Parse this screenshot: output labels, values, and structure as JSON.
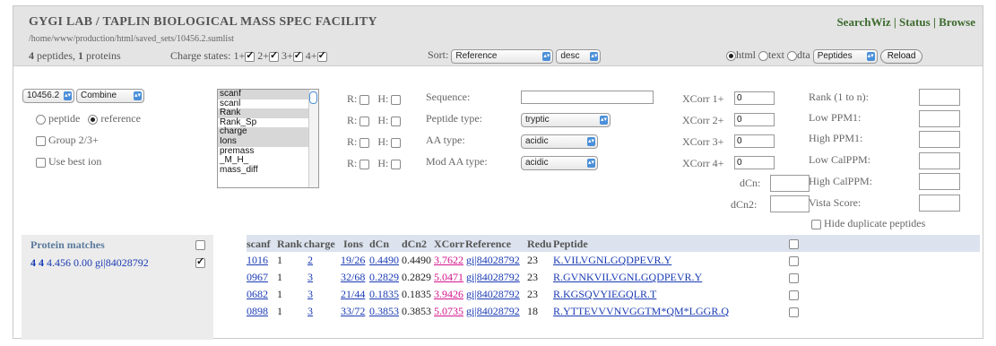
{
  "header": {
    "title": "GYGI LAB / TAPLIN BIOLOGICAL MASS SPEC FACILITY",
    "path": "/home/www/production/html/saved_sets/10456.2.sumlist",
    "nav": [
      "SearchWiz",
      "Status",
      "Browse"
    ],
    "summary": {
      "peptides_count": "4",
      "peptides_label": "peptides,",
      "proteins_count": "1",
      "proteins_label": "proteins"
    },
    "charge_states_label": "Charge states:",
    "charge_states": [
      {
        "label": "1+",
        "checked": true
      },
      {
        "label": "2+",
        "checked": true
      },
      {
        "label": "3+",
        "checked": true
      },
      {
        "label": "4+",
        "checked": true
      }
    ],
    "sort_label": "Sort:",
    "sort_value": "Reference",
    "sort_order": "desc",
    "formats": [
      {
        "label": "html",
        "selected": true
      },
      {
        "label": "text",
        "selected": false
      },
      {
        "label": "dta",
        "selected": false
      }
    ],
    "view_value": "Peptides",
    "reload_label": "Reload"
  },
  "controls": {
    "set_select": "10456.2",
    "combine_select": "Combine",
    "peptide_label": "peptide",
    "reference_label": "reference",
    "group_label": "Group 2/3+",
    "best_ion_label": "Use best ion",
    "columns_list": [
      {
        "label": "scanf",
        "highlighted": true
      },
      {
        "label": "scanl",
        "highlighted": false
      },
      {
        "label": "Rank",
        "highlighted": true
      },
      {
        "label": "Rank_Sp",
        "highlighted": false
      },
      {
        "label": "charge",
        "highlighted": true
      },
      {
        "label": "Ions",
        "highlighted": true
      },
      {
        "label": "premass",
        "highlighted": false
      },
      {
        "label": "_M_H_",
        "highlighted": false
      },
      {
        "label": "mass_diff",
        "highlighted": false
      }
    ],
    "r_label": "R:",
    "h_label": "H:",
    "filters": [
      {
        "label": "Sequence:",
        "type": "text",
        "value": ""
      },
      {
        "label": "Peptide type:",
        "type": "select",
        "value": "tryptic"
      },
      {
        "label": "AA type:",
        "type": "select",
        "value": "acidic"
      },
      {
        "label": "Mod AA type:",
        "type": "select",
        "value": "acidic"
      }
    ],
    "xcorr": [
      {
        "label": "XCorr 1+",
        "value": "0"
      },
      {
        "label": "XCorr 2+",
        "value": "0"
      },
      {
        "label": "XCorr 3+",
        "value": "0"
      },
      {
        "label": "XCorr 4+",
        "value": "0"
      }
    ],
    "dcn_label": "dCn:",
    "dcn2_label": "dCn2:",
    "right_fields": [
      {
        "label": "Rank (1 to n):"
      },
      {
        "label": "Low PPM1:"
      },
      {
        "label": "High PPM1:"
      },
      {
        "label": "Low CalPPM:"
      },
      {
        "label": "High CalPPM:"
      },
      {
        "label": "Vista Score:"
      }
    ],
    "hide_dup_label": "Hide duplicate peptides"
  },
  "protein_panel": {
    "title": "Protein matches",
    "row": {
      "n1": "4",
      "n2": "4",
      "score": "4.456",
      "val": "0.00",
      "ref": "gi|84028792",
      "checked": true
    }
  },
  "table": {
    "headers": [
      "scanf",
      "Rank",
      "charge",
      "Ions",
      "dCn",
      "dCn2",
      "XCorr",
      "Reference",
      "Redu",
      "Peptide"
    ],
    "rows": [
      {
        "scanf": "1016",
        "rank": "1",
        "charge": "2",
        "ions": "19/26",
        "dcn": "0.4490",
        "dcn2": "0.4490",
        "xcorr": "3.7622",
        "reference": "gi|84028792",
        "redu": "23",
        "peptide": "K.VILVGNLGQDPEVR.Y"
      },
      {
        "scanf": "0967",
        "rank": "1",
        "charge": "3",
        "ions": "32/68",
        "dcn": "0.2829",
        "dcn2": "0.2829",
        "xcorr": "5.0471",
        "reference": "gi|84028792",
        "redu": "23",
        "peptide": "R.GVNKVILVGNLGQDPEVR.Y"
      },
      {
        "scanf": "0682",
        "rank": "1",
        "charge": "3",
        "ions": "21/44",
        "dcn": "0.1835",
        "dcn2": "0.1835",
        "xcorr": "3.9426",
        "reference": "gi|84028792",
        "redu": "23",
        "peptide": "R.KGSQVYIEGQLR.T"
      },
      {
        "scanf": "0898",
        "rank": "1",
        "charge": "3",
        "ions": "33/72",
        "dcn": "0.3853",
        "dcn2": "0.3853",
        "xcorr": "5.0735",
        "reference": "gi|84028792",
        "redu": "18",
        "peptide": "R.YTTEVVVNVGGTM*QM*LGGR.Q"
      }
    ]
  }
}
